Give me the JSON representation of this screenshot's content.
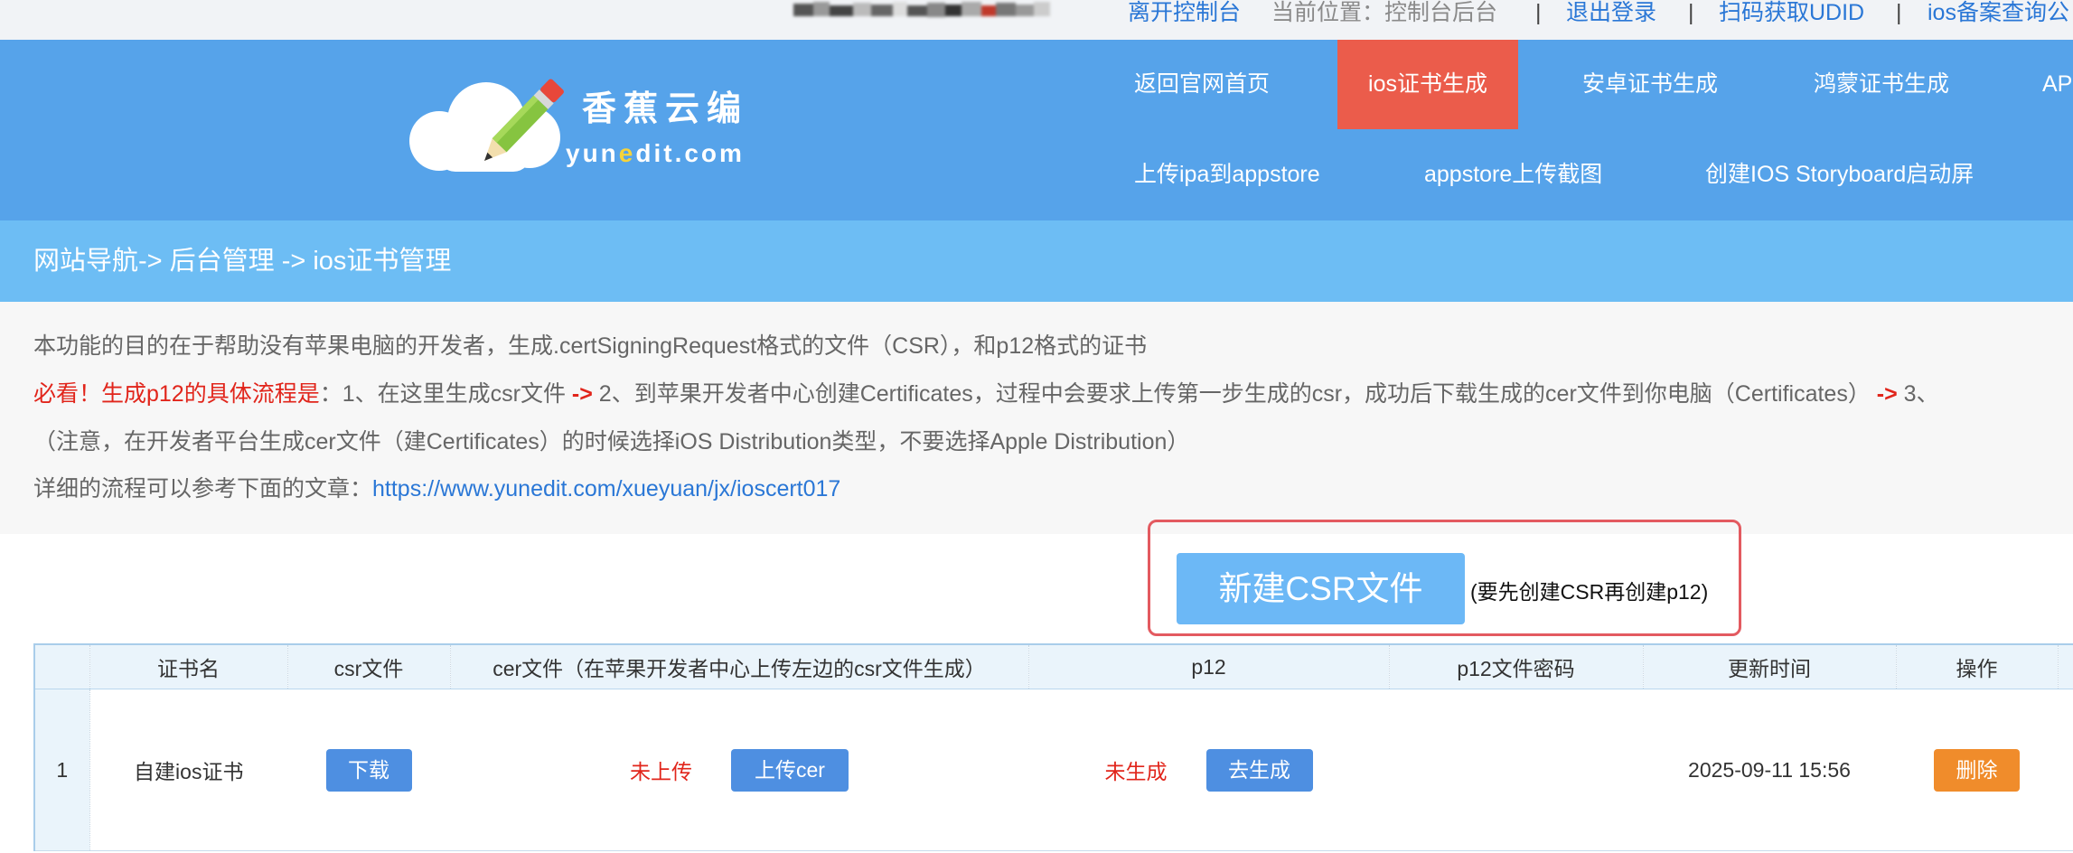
{
  "topbar": {
    "leave_console": "离开控制台",
    "location": "当前位置：控制台后台",
    "separator": "|",
    "logout": "退出登录",
    "scan_udid": "扫码获取UDID",
    "beian_query": "ios备案查询公"
  },
  "logo": {
    "icon": "cloud-pencil-icon",
    "name": "香蕉云编",
    "domain_before": "yun",
    "domain_accent": "e",
    "domain_after": "dit.com"
  },
  "nav": {
    "primary": [
      {
        "label": "返回官网首页"
      },
      {
        "label": "ios证书生成",
        "active": true
      },
      {
        "label": "安卓证书生成"
      },
      {
        "label": "鸿蒙证书生成"
      },
      {
        "label": "AP"
      }
    ],
    "secondary": [
      {
        "label": "上传ipa到appstore"
      },
      {
        "label": "appstore上传截图"
      },
      {
        "label": "创建IOS Storyboard启动屏"
      }
    ]
  },
  "breadcrumb": "网站导航-> 后台管理 -> ios证书管理",
  "intro": {
    "purpose": "本功能的目的在于帮助没有苹果电脑的开发者，生成.certSigningRequest格式的文件（CSR），和p12格式的证书",
    "must_read": "必看！生成p12的具体流程是",
    "step1": "：1、在这里生成csr文件 ",
    "arrow": "->",
    "step2": " 2、到苹果开发者中心创建Certificates，过程中会要求上传第一步生成的csr，成功后下载生成的cer文件到你电脑（Certificates） ",
    "step3": " 3、",
    "note": "（注意，在开发者平台生成cer文件（建Certificates）的时候选择iOS Distribution类型，不要选择Apple Distribution）",
    "detail_label": "详细的流程可以参考下面的文章：",
    "detail_link": "https://www.yunedit.com/xueyuan/jx/ioscert017"
  },
  "create_csr": {
    "button_label": "新建CSR文件",
    "hint": "(要先创建CSR再创建p12)"
  },
  "table": {
    "columns": [
      "证书名",
      "csr文件",
      "cer文件（在苹果开发者中心上传左边的csr文件生成）",
      "p12",
      "p12文件密码",
      "更新时间",
      "操作"
    ],
    "rows": [
      {
        "index": "1",
        "name": "自建ios证书",
        "csr_action": "下载",
        "cer_status": "未上传",
        "cer_action": "上传cer",
        "p12_status": "未生成",
        "p12_action": "去生成",
        "updated": "2025-09-11 15:56",
        "delete_action": "删除"
      }
    ]
  },
  "colors": {
    "topbar_bg": "#f1f3f6",
    "header_blue": "#56a3ea",
    "active_tab": "#eb5c4b",
    "breadcrumb_blue": "#6dbdf4",
    "intro_bg": "#f7f7f7",
    "link_blue": "#2a77d6",
    "warning_red": "#e1251b",
    "csr_button": "#6cb8f6",
    "highlight_border": "#e35a60",
    "action_blue": "#4e8fe1",
    "delete_orange": "#f08c2b",
    "table_header_bg": "#eaf4fb"
  }
}
